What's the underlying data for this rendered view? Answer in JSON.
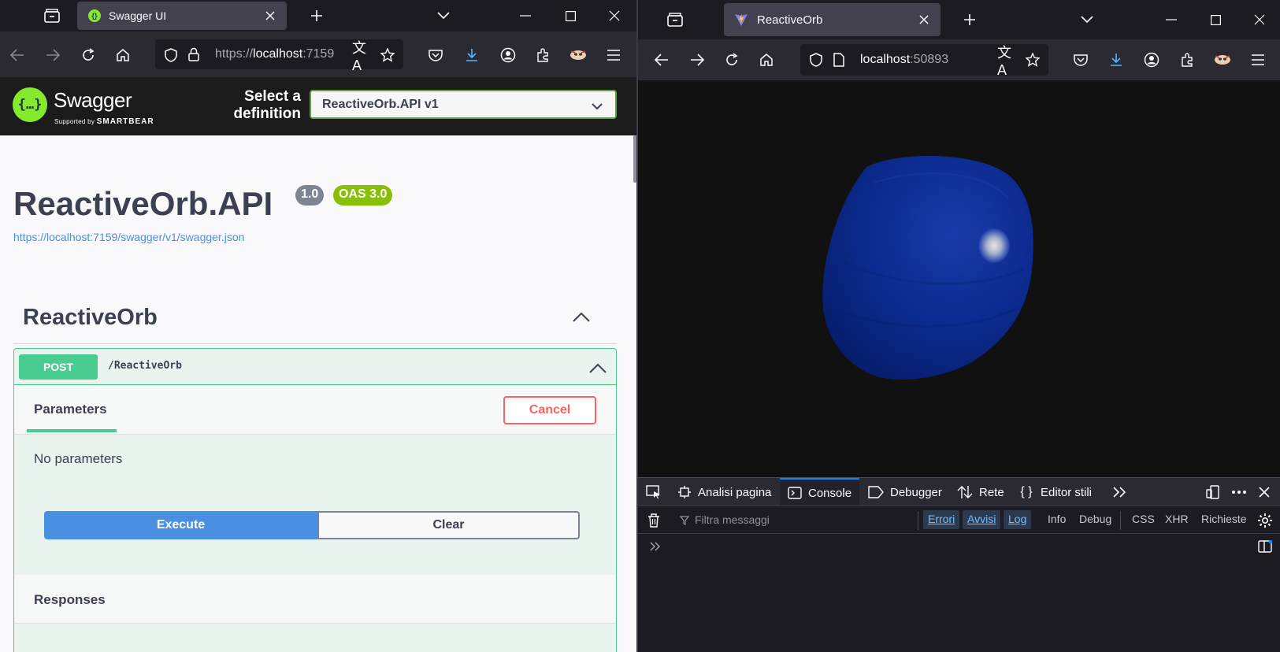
{
  "left_window": {
    "tab_title": "Swagger UI",
    "url_prefix": "https://",
    "url_host": "localhost",
    "url_rest": ":7159",
    "swagger": {
      "logo_text": "Swagger",
      "logo_sub_prefix": "Supported by",
      "logo_sub_brand": "SMARTBEAR",
      "select_label": "Select a definition",
      "select_value": "ReactiveOrb.API v1",
      "api_title": "ReactiveOrb.API",
      "version_badge": "1.0",
      "oas_badge": "OAS 3.0",
      "spec_url": "https://localhost:7159/swagger/v1/swagger.json",
      "tag_name": "ReactiveOrb",
      "operation": {
        "method": "POST",
        "path": "/ReactiveOrb",
        "parameters_title": "Parameters",
        "cancel_label": "Cancel",
        "no_params_text": "No parameters",
        "execute_label": "Execute",
        "clear_label": "Clear",
        "responses_title": "Responses"
      }
    }
  },
  "right_window": {
    "tab_title": "ReactiveOrb",
    "url_host": "localhost",
    "url_port": ":50893",
    "devtools": {
      "tabs": [
        "Analisi pagina",
        "Console",
        "Debugger",
        "Rete",
        "Editor stili"
      ],
      "active_tab": "Console",
      "filter_placeholder": "Filtra messaggi",
      "filter_chips": [
        "Errori",
        "Avvisi",
        "Log"
      ],
      "filter_items": [
        "Info",
        "Debug",
        "CSS",
        "XHR",
        "Richieste"
      ]
    }
  },
  "colors": {
    "swagger_green": "#49cc90",
    "execute_blue": "#4990e2",
    "cancel_red": "#ff6060",
    "orb_blue": "#0a2a8a"
  }
}
